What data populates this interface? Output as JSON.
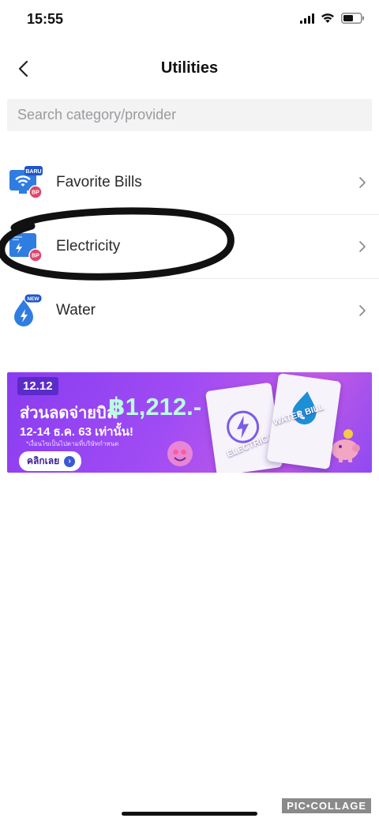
{
  "status_bar": {
    "time": "15:55"
  },
  "header": {
    "title": "Utilities"
  },
  "search": {
    "placeholder": "Search category/provider"
  },
  "list": {
    "items": [
      {
        "label": "Favorite Bills",
        "badge": "BARU",
        "sub_badge": "BP"
      },
      {
        "label": "Electricity",
        "sub_badge": "BP"
      },
      {
        "label": "Water",
        "badge": "NEW"
      }
    ]
  },
  "banner": {
    "tag": "12.12",
    "headline": "ส่วนลดจ่ายบิล",
    "amount": "฿1,212.-",
    "dates": "12-14 ธ.ค. 63 เท่านั้น!",
    "note": "*เงื่อนไขเป็นไปตามที่บริษัทกำหนด",
    "cta": "คลิกเลย",
    "card_left": "ELECTRIC BILL",
    "card_right": "WATER BILL"
  },
  "watermark": "PIC•COLLAGE",
  "colors": {
    "accent_blue": "#2f7de0",
    "badge_pink": "#e0456a",
    "banner_purple": "#8a3cf0"
  }
}
